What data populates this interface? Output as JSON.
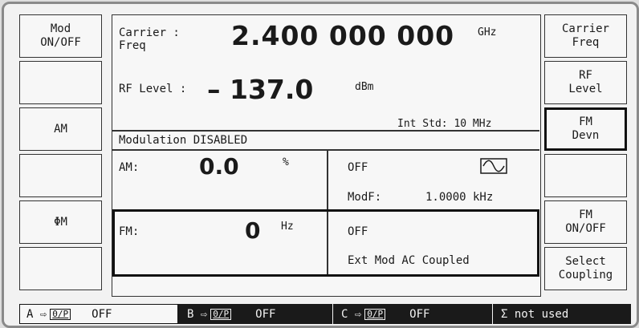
{
  "left_softkeys": [
    {
      "line1": "Mod",
      "line2": "ON/OFF"
    },
    {
      "line1": "",
      "line2": ""
    },
    {
      "line1": "AM",
      "line2": ""
    },
    {
      "line1": "",
      "line2": ""
    },
    {
      "line1": "ΦM",
      "line2": ""
    },
    {
      "line1": "",
      "line2": ""
    }
  ],
  "right_softkeys": [
    {
      "line1": "Carrier",
      "line2": "Freq"
    },
    {
      "line1": "RF",
      "line2": "Level"
    },
    {
      "line1": "FM",
      "line2": "Devn",
      "active": true
    },
    {
      "line1": "",
      "line2": ""
    },
    {
      "line1": "FM",
      "line2": "ON/OFF"
    },
    {
      "line1": "Select",
      "line2": "Coupling"
    }
  ],
  "carrier": {
    "label1": "Carrier  :",
    "label2": "Freq",
    "value": "2.400 000 000",
    "unit": "GHz"
  },
  "rf_level": {
    "label": "RF Level :",
    "value": "– 137.0",
    "unit": "dBm"
  },
  "int_std": "Int Std: 10 MHz",
  "modulation_status": "Modulation DISABLED",
  "am": {
    "label": "AM:",
    "value": "0.0",
    "unit": "%",
    "state": "OFF",
    "modf_label": "ModF:",
    "modf_value": "1.0000 kHz",
    "waveform": "sine-wave-icon"
  },
  "fm": {
    "label": "FM:",
    "value": "0",
    "unit": "Hz",
    "state": "OFF",
    "coupling": "Ext Mod AC Coupled"
  },
  "status_bar": {
    "a": {
      "label": "A ⇨",
      "box": "0/P",
      "state": "OFF"
    },
    "b": {
      "label": "B ⇨",
      "box": "0/P",
      "state": "OFF"
    },
    "c": {
      "label": "C ⇨",
      "box": "0/P",
      "state": "OFF"
    },
    "sigma": "Σ not used"
  }
}
